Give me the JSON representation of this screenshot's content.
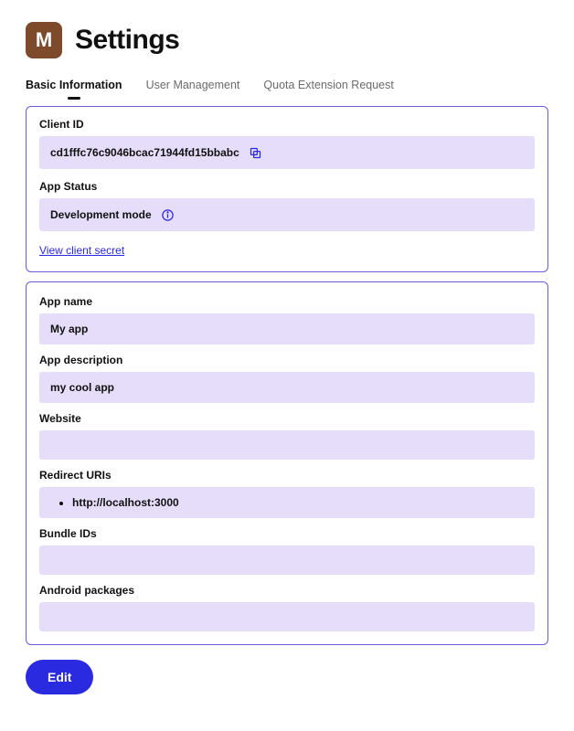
{
  "header": {
    "logo_letter": "M",
    "title": "Settings"
  },
  "tabs": [
    {
      "label": "Basic Information",
      "active": true
    },
    {
      "label": "User Management",
      "active": false
    },
    {
      "label": "Quota Extension Request",
      "active": false
    }
  ],
  "panel1": {
    "client_id_label": "Client ID",
    "client_id_value": "cd1fffc76c9046bcac71944fd15bbabc",
    "app_status_label": "App Status",
    "app_status_value": "Development mode",
    "view_secret_link": "View client secret"
  },
  "panel2": {
    "app_name_label": "App name",
    "app_name_value": "My app",
    "app_description_label": "App description",
    "app_description_value": "my cool app",
    "website_label": "Website",
    "website_value": "",
    "redirect_uris_label": "Redirect URIs",
    "redirect_uris": [
      "http://localhost:3000"
    ],
    "bundle_ids_label": "Bundle IDs",
    "bundle_ids_value": "",
    "android_packages_label": "Android packages",
    "android_packages_value": ""
  },
  "actions": {
    "edit_label": "Edit"
  }
}
